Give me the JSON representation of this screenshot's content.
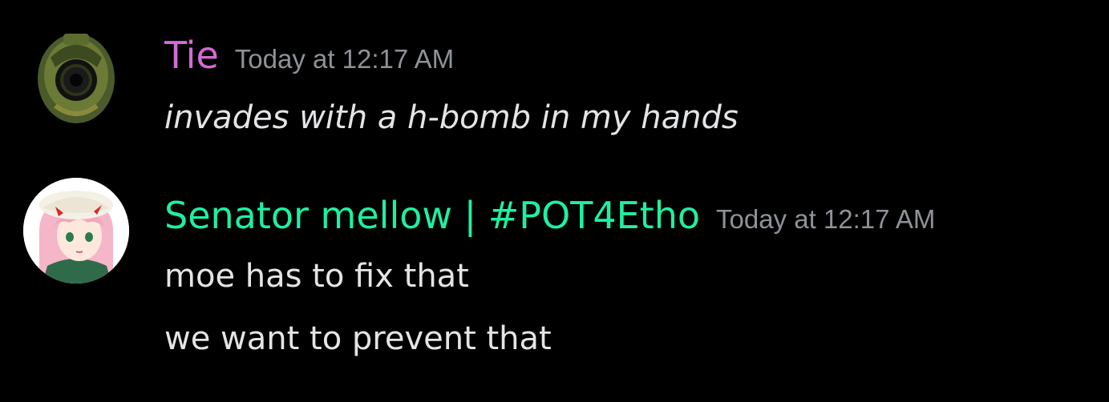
{
  "messages": [
    {
      "author": "Tie",
      "author_color": "#d36bd6",
      "timestamp": "Today at 12:17 AM",
      "avatar_icon": "green-helmet-avatar",
      "lines": [
        "invades with a h-bomb in my hands"
      ]
    },
    {
      "author": "Senator mellow | #POT4Etho",
      "author_color": "#1ef0a0",
      "timestamp": "Today at 12:17 AM",
      "avatar_icon": "anime-girl-avatar",
      "lines": [
        "moe has to fix that",
        "we want to prevent that"
      ]
    }
  ]
}
